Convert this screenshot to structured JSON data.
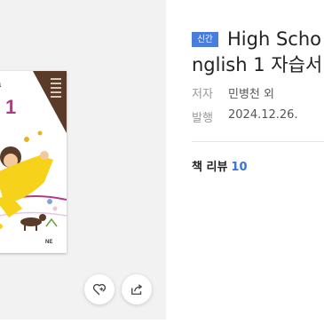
{
  "cover": {
    "title_small": "a",
    "title_number": "1",
    "publisher": "NE"
  },
  "actions": {
    "wish_icon": "heart-plus-icon",
    "share_icon": "share-icon"
  },
  "book": {
    "badge": "신간",
    "title_line1": "High Scho",
    "title_line2": "nglish 1 자습서",
    "author_label": "저자",
    "author_value": "민병천 외",
    "date_label": "발행",
    "date_value": "2024.12.26."
  },
  "review": {
    "label": "책 리뷰",
    "count": "10"
  },
  "colors": {
    "accent": "#4a7ddb",
    "review_count": "#3a72d6",
    "panel_bg": "#f2f2f2"
  }
}
